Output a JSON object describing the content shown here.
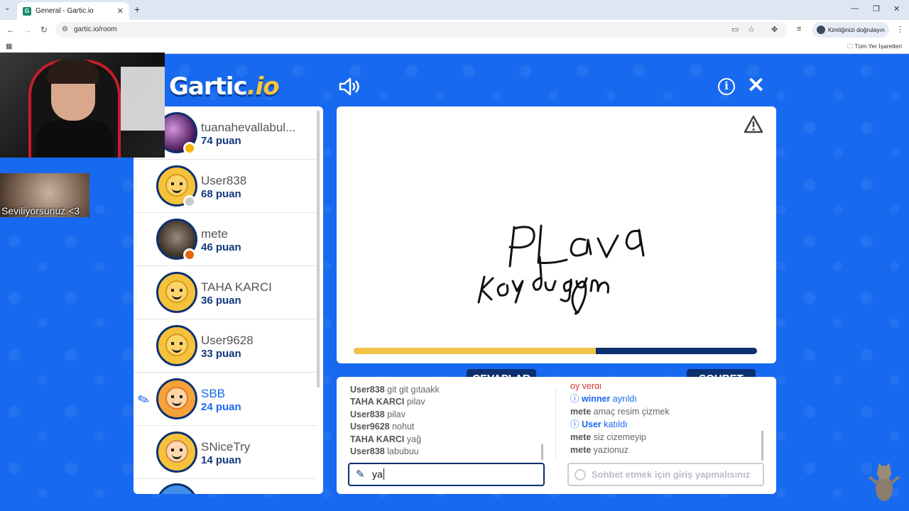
{
  "browser": {
    "tab_title": "General - Gartic.io",
    "url": "gartic.io/room",
    "profile_label": "Kimliğinizi doğrulayın",
    "bookmarks_all": "Tüm Yer İşaretleri"
  },
  "game": {
    "logo_main": "Gartic",
    "logo_suffix": ".io",
    "players": [
      {
        "name": "tuanahevallabul...",
        "score": "74 puan",
        "avatar": "photo1",
        "status": "#f5b400",
        "drawing": false
      },
      {
        "name": "User838",
        "score": "68 puan",
        "avatar": "default",
        "status": "#c9c9c9",
        "drawing": false
      },
      {
        "name": "mete",
        "score": "46 puan",
        "avatar": "photo2",
        "status": "#e0660f",
        "drawing": false
      },
      {
        "name": "TAHA KARCI",
        "score": "36 puan",
        "avatar": "default",
        "status": "",
        "drawing": false
      },
      {
        "name": "User9628",
        "score": "33 puan",
        "avatar": "default",
        "status": "",
        "drawing": false
      },
      {
        "name": "SBB",
        "score": "24 puan",
        "avatar": "orange",
        "status": "",
        "drawing": true
      },
      {
        "name": "SNiceTry",
        "score": "14 puan",
        "avatar": "pale",
        "status": "",
        "drawing": false
      }
    ],
    "progress": 0.6,
    "answers_tab": "CEVAPLAR",
    "chat_tab": "SOHBET",
    "answers": [
      {
        "user": "User838",
        "text": "git git gıtaakk"
      },
      {
        "user": "TAHA KARCI",
        "text": "pilav"
      },
      {
        "user": "User838",
        "text": "pilav"
      },
      {
        "user": "User9628",
        "text": "nohut"
      },
      {
        "user": "TAHA KARCI",
        "text": "yağ"
      },
      {
        "user": "User838",
        "text": "labubuu"
      }
    ],
    "chat_partial": "oy verdi",
    "chat": [
      {
        "type": "sys",
        "user": "winner",
        "text": "ayrıldı"
      },
      {
        "type": "msg",
        "user": "mete",
        "text": "amaç resim çizmek"
      },
      {
        "type": "sys",
        "user": "User",
        "text": "katıldı"
      },
      {
        "type": "msg",
        "user": "mete",
        "text": "siz cizemeyip"
      },
      {
        "type": "msg",
        "user": "mete",
        "text": "yazionuz"
      }
    ],
    "answer_input_value": "ya",
    "chat_input_placeholder": "Sohbet etmek için giriş yapmalısınız"
  },
  "overlay": {
    "clip_text": "Seviliyorsunuz <3"
  }
}
